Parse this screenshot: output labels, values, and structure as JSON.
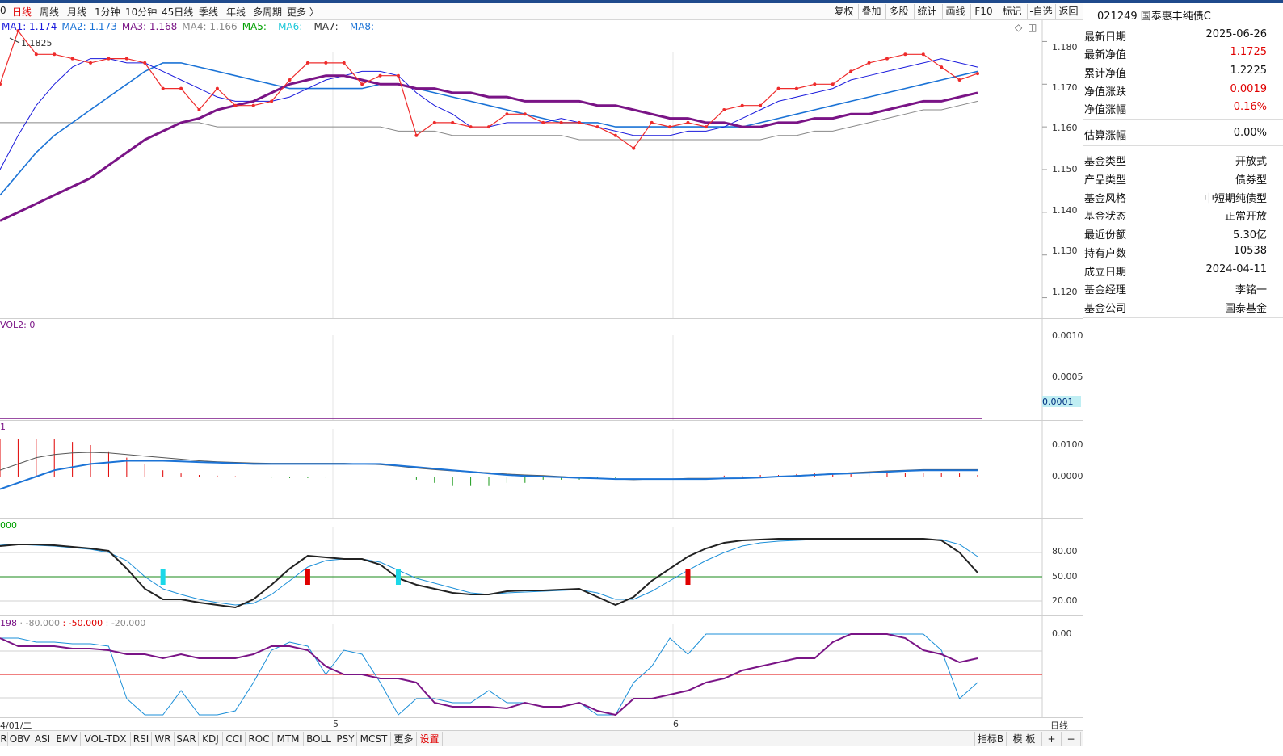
{
  "toolbar": {
    "periods": [
      {
        "label": "0"
      },
      {
        "label": "日线"
      },
      {
        "label": "周线"
      },
      {
        "label": "月线"
      },
      {
        "label": "1分钟"
      },
      {
        "label": "10分钟"
      },
      {
        "label": "45日线"
      },
      {
        "label": "季线"
      },
      {
        "label": "年线"
      },
      {
        "label": "多周期"
      },
      {
        "label": "更多 〉"
      }
    ],
    "right_buttons": [
      {
        "label": "复权"
      },
      {
        "label": "叠加"
      },
      {
        "label": "多股"
      },
      {
        "label": "统计"
      },
      {
        "label": "画线"
      },
      {
        "label": "F10"
      },
      {
        "label": "标记"
      },
      {
        "label": "-自选"
      },
      {
        "label": "返回"
      }
    ]
  },
  "legend": {
    "ma1": "MA1: 1.174",
    "ma2": "MA2: 1.173",
    "ma3": "MA3: 1.168",
    "ma4": "MA4: 1.166",
    "ma5": "MA5: -",
    "ma6": "MA6: -",
    "ma7": "MA7: -",
    "ma8": "MA8: -",
    "high_label": "1.1825",
    "colors": {
      "ma1": "#1a1adc",
      "ma2": "#1b73d6",
      "ma3": "#7a1486",
      "ma4": "#888888",
      "ma5": "#00a000",
      "ma6": "#1bc7d8",
      "ma7": "#333333",
      "ma8": "#1b73d6",
      "price": "#ee2b2b"
    }
  },
  "main_axis": [
    "1.180",
    "1.170",
    "1.160",
    "1.150",
    "1.140",
    "1.130",
    "1.120"
  ],
  "vol": {
    "title": "VOL2: 0",
    "axis": [
      "0.0010",
      "0.0005"
    ],
    "current": "0.0001"
  },
  "macd": {
    "title": "1",
    "axis": [
      "0.0100",
      "0.0000"
    ]
  },
  "kdj": {
    "title": "000",
    "axis": [
      "80.00",
      "50.00",
      "20.00"
    ]
  },
  "wr": {
    "title_a": "198",
    "title_b": "· -80.000",
    "title_c": ": -50.000",
    "title_d": ": -20.000",
    "axis": [
      "0.00"
    ]
  },
  "x_axis": {
    "left_date": "4/01/二",
    "m5": "5",
    "m6": "6",
    "period_label": "日线"
  },
  "bottom_tabs": [
    {
      "label": "R"
    },
    {
      "label": "OBV"
    },
    {
      "label": "ASI"
    },
    {
      "label": "EMV"
    },
    {
      "label": "VOL-TDX"
    },
    {
      "label": "RSI"
    },
    {
      "label": "WR"
    },
    {
      "label": "SAR"
    },
    {
      "label": "KDJ"
    },
    {
      "label": "CCI"
    },
    {
      "label": "ROC"
    },
    {
      "label": "MTM"
    },
    {
      "label": "BOLL"
    },
    {
      "label": "PSY"
    },
    {
      "label": "MCST"
    },
    {
      "label": "更多"
    },
    {
      "label": "设置"
    }
  ],
  "bottom_right": {
    "indicator": "指标B",
    "template": "模 板",
    "plus": "+",
    "minus": "−"
  },
  "fund": {
    "title": "021249 国泰惠丰纯债C",
    "rows1": [
      {
        "k": "最新日期",
        "v": "2025-06-26",
        "red": false
      },
      {
        "k": "最新净值",
        "v": "1.1725",
        "red": true
      },
      {
        "k": "累计净值",
        "v": "1.2225",
        "red": false
      },
      {
        "k": "净值涨跌",
        "v": "0.0019",
        "red": true
      },
      {
        "k": "净值涨幅",
        "v": "0.16%",
        "red": true
      }
    ],
    "rows2": [
      {
        "k": "估算涨幅",
        "v": "0.00%",
        "red": false
      }
    ],
    "rows3": [
      {
        "k": "基金类型",
        "v": "开放式"
      },
      {
        "k": "产品类型",
        "v": "债券型"
      },
      {
        "k": "基金风格",
        "v": "中短期纯债型"
      },
      {
        "k": "基金状态",
        "v": "正常开放"
      },
      {
        "k": "最近份额",
        "v": "5.30亿"
      },
      {
        "k": "持有户数",
        "v": "10538"
      },
      {
        "k": "成立日期",
        "v": "2024-04-11"
      },
      {
        "k": "基金经理",
        "v": "李铭一"
      },
      {
        "k": "基金公司",
        "v": "国泰基金"
      }
    ]
  },
  "chart_data": {
    "type": "line",
    "title": "",
    "ylim": [
      1.115,
      1.185
    ],
    "x_labels": [
      "5",
      "6"
    ],
    "series": [
      {
        "name": "",
        "color": "#ee2b2b",
        "values": [
          1.17,
          1.1825,
          1.177,
          1.177,
          1.176,
          1.175,
          1.176,
          1.176,
          1.175,
          1.169,
          1.169,
          1.164,
          1.169,
          1.165,
          1.165,
          1.166,
          1.171,
          1.175,
          1.175,
          1.175,
          1.17,
          1.172,
          1.172,
          1.158,
          1.161,
          1.161,
          1.16,
          1.16,
          1.163,
          1.163,
          1.161,
          1.161,
          1.161,
          1.16,
          1.158,
          1.155,
          1.161,
          1.16,
          1.161,
          1.16,
          1.164,
          1.165,
          1.165,
          1.169,
          1.169,
          1.17,
          1.17,
          1.173,
          1.175,
          1.176,
          1.177,
          1.177,
          1.174,
          1.171,
          1.1725
        ]
      },
      {
        "name": "MA1",
        "color": "#1a1adc",
        "values": [
          1.15,
          1.158,
          1.165,
          1.17,
          1.174,
          1.176,
          1.176,
          1.175,
          1.175,
          1.173,
          1.171,
          1.169,
          1.167,
          1.166,
          1.166,
          1.166,
          1.167,
          1.169,
          1.171,
          1.172,
          1.173,
          1.173,
          1.172,
          1.168,
          1.165,
          1.163,
          1.16,
          1.16,
          1.161,
          1.161,
          1.161,
          1.162,
          1.161,
          1.16,
          1.159,
          1.158,
          1.158,
          1.158,
          1.159,
          1.159,
          1.16,
          1.162,
          1.164,
          1.166,
          1.167,
          1.168,
          1.169,
          1.171,
          1.172,
          1.173,
          1.174,
          1.175,
          1.176,
          1.175,
          1.174
        ]
      },
      {
        "name": "MA2",
        "color": "#1b73d6",
        "values": [
          1.144,
          1.149,
          1.154,
          1.158,
          1.161,
          1.164,
          1.167,
          1.17,
          1.173,
          1.175,
          1.175,
          1.174,
          1.173,
          1.172,
          1.171,
          1.17,
          1.169,
          1.169,
          1.169,
          1.169,
          1.169,
          1.17,
          1.17,
          1.169,
          1.168,
          1.167,
          1.166,
          1.165,
          1.164,
          1.163,
          1.162,
          1.161,
          1.161,
          1.161,
          1.16,
          1.16,
          1.16,
          1.16,
          1.16,
          1.16,
          1.16,
          1.16,
          1.161,
          1.162,
          1.163,
          1.164,
          1.165,
          1.166,
          1.167,
          1.168,
          1.169,
          1.17,
          1.171,
          1.172,
          1.173
        ]
      },
      {
        "name": "MA3",
        "color": "#7a1486",
        "values": [
          1.138,
          1.14,
          1.142,
          1.144,
          1.146,
          1.148,
          1.151,
          1.154,
          1.157,
          1.159,
          1.161,
          1.162,
          1.164,
          1.165,
          1.166,
          1.168,
          1.17,
          1.171,
          1.172,
          1.172,
          1.171,
          1.17,
          1.17,
          1.169,
          1.169,
          1.168,
          1.168,
          1.167,
          1.167,
          1.166,
          1.166,
          1.166,
          1.166,
          1.165,
          1.165,
          1.164,
          1.163,
          1.162,
          1.162,
          1.161,
          1.161,
          1.16,
          1.16,
          1.161,
          1.161,
          1.162,
          1.162,
          1.163,
          1.163,
          1.164,
          1.165,
          1.166,
          1.166,
          1.167,
          1.168
        ]
      },
      {
        "name": "MA4",
        "color": "#888888",
        "values": [
          1.161,
          1.161,
          1.161,
          1.161,
          1.161,
          1.161,
          1.161,
          1.161,
          1.161,
          1.161,
          1.161,
          1.161,
          1.16,
          1.16,
          1.16,
          1.16,
          1.16,
          1.16,
          1.16,
          1.16,
          1.16,
          1.16,
          1.159,
          1.159,
          1.159,
          1.158,
          1.158,
          1.158,
          1.158,
          1.158,
          1.158,
          1.158,
          1.157,
          1.157,
          1.157,
          1.157,
          1.157,
          1.157,
          1.157,
          1.157,
          1.157,
          1.157,
          1.157,
          1.158,
          1.158,
          1.159,
          1.159,
          1.16,
          1.161,
          1.162,
          1.163,
          1.164,
          1.164,
          1.165,
          1.166
        ]
      }
    ],
    "indicators": {
      "macd_hist": [
        0.012,
        0.012,
        0.012,
        0.012,
        0.011,
        0.01,
        0.008,
        0.006,
        0.004,
        0.002,
        0.001,
        0.0005,
        0.0003,
        0.0001,
        0.0,
        -0.0003,
        -0.0005,
        -0.0005,
        -0.0003,
        -0.0002,
        0.0,
        0.0,
        0.0,
        -0.001,
        -0.002,
        -0.003,
        -0.003,
        -0.003,
        -0.002,
        -0.002,
        -0.001,
        -0.001,
        -0.001,
        -0.0005,
        -0.0005,
        0.0,
        0.0,
        0.0,
        0.0,
        0.0,
        0.0003,
        0.0003,
        0.0005,
        0.0005,
        0.0008,
        0.001,
        0.001,
        0.001,
        0.0012,
        0.0012,
        0.0012,
        0.0012,
        0.0012,
        0.001,
        0.0005
      ],
      "macd_dif": [
        -0.004,
        -0.002,
        0.0,
        0.002,
        0.003,
        0.004,
        0.0045,
        0.005,
        0.005,
        0.005,
        0.0048,
        0.0046,
        0.0044,
        0.0042,
        0.004,
        0.004,
        0.004,
        0.004,
        0.004,
        0.004,
        0.004,
        0.004,
        0.0035,
        0.003,
        0.0025,
        0.002,
        0.0015,
        0.001,
        0.0005,
        0.0002,
        0.0,
        -0.0002,
        -0.0004,
        -0.0006,
        -0.0008,
        -0.0008,
        -0.0008,
        -0.0008,
        -0.0008,
        -0.0008,
        -0.0006,
        -0.0005,
        -0.0003,
        0.0,
        0.0002,
        0.0005,
        0.0008,
        0.001,
        0.0012,
        0.0015,
        0.0018,
        0.002,
        0.002,
        0.002,
        0.002
      ],
      "macd_dea": [
        0.002,
        0.004,
        0.006,
        0.007,
        0.0075,
        0.0077,
        0.0075,
        0.007,
        0.0065,
        0.006,
        0.0055,
        0.005,
        0.0047,
        0.0045,
        0.0043,
        0.0042,
        0.0042,
        0.0042,
        0.0042,
        0.0042,
        0.004,
        0.0038,
        0.0033,
        0.0027,
        0.0022,
        0.0018,
        0.0015,
        0.0012,
        0.0008,
        0.0005,
        0.0003,
        0.0,
        -0.0003,
        -0.0006,
        -0.0008,
        -0.001,
        -0.0008,
        -0.0008,
        -0.0006,
        -0.0006,
        -0.0005,
        -0.0005,
        -0.0003,
        0.0,
        0.0003,
        0.0006,
        0.0009,
        0.0012,
        0.0015,
        0.0018,
        0.002,
        0.0022,
        0.0022,
        0.0022,
        0.0022
      ],
      "kdj_k": [
        88,
        90,
        90,
        89,
        87,
        85,
        82,
        60,
        35,
        22,
        22,
        18,
        15,
        12,
        22,
        40,
        60,
        76,
        74,
        72,
        72,
        65,
        48,
        40,
        35,
        30,
        28,
        28,
        32,
        33,
        33,
        34,
        35,
        25,
        15,
        25,
        45,
        60,
        75,
        85,
        92,
        95,
        96,
        97,
        97,
        97,
        97,
        97,
        97,
        97,
        97,
        97,
        95,
        80,
        55
      ],
      "kdj_d": [
        90,
        90,
        89,
        88,
        86,
        84,
        80,
        70,
        50,
        35,
        28,
        22,
        18,
        15,
        17,
        28,
        45,
        62,
        70,
        72,
        72,
        68,
        58,
        48,
        42,
        36,
        30,
        28,
        30,
        31,
        32,
        33,
        34,
        30,
        22,
        22,
        32,
        45,
        58,
        70,
        80,
        88,
        92,
        94,
        95,
        96,
        96,
        96,
        96,
        96,
        96,
        96,
        96,
        90,
        75
      ],
      "wr_1": [
        -5,
        -5,
        -10,
        -10,
        -12,
        -12,
        -15,
        -80,
        -100,
        -100,
        -70,
        -100,
        -100,
        -95,
        -60,
        -20,
        -10,
        -15,
        -50,
        -20,
        -25,
        -60,
        -100,
        -80,
        -80,
        -85,
        -85,
        -70,
        -85,
        -85,
        -90,
        -90,
        -85,
        -100,
        -100,
        -60,
        -40,
        -5,
        -25,
        0,
        0,
        0,
        0,
        0,
        0,
        0,
        0,
        0,
        0,
        0,
        0,
        0,
        -20,
        -80,
        -60
      ],
      "wr_2": [
        -5,
        -15,
        -15,
        -15,
        -18,
        -18,
        -20,
        -25,
        -25,
        -30,
        -25,
        -30,
        -30,
        -30,
        -25,
        -15,
        -15,
        -20,
        -40,
        -50,
        -50,
        -55,
        -55,
        -60,
        -85,
        -90,
        -90,
        -90,
        -92,
        -85,
        -90,
        -90,
        -85,
        -95,
        -100,
        -80,
        -80,
        -75,
        -70,
        -60,
        -55,
        -45,
        -40,
        -35,
        -30,
        -30,
        -10,
        0,
        0,
        0,
        -5,
        -20,
        -25,
        -35,
        -30
      ]
    }
  }
}
